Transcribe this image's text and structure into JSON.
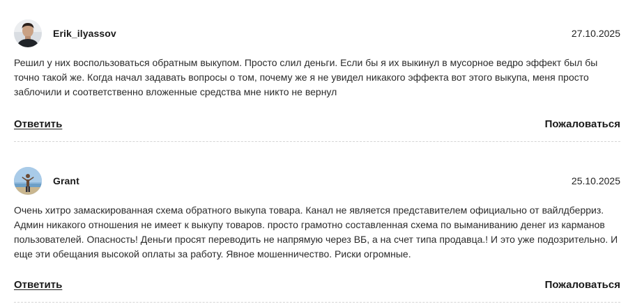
{
  "reviews": [
    {
      "author": "Erik_ilyassov",
      "date": "27.10.2025",
      "text": "Решил у них воспользоваться обратным выкупом. Просто слил деньги. Если бы я их выкинул в мусорное ведро эффект был бы точно такой же. Когда начал задавать вопросы о том, почему же я не увидел никакого эффекта вот этого выкупа, меня просто заблочили и соответственно вложенные средства мне никто не вернул",
      "reply_label": "Ответить",
      "complain_label": "Пожаловаться",
      "avatar_icon": "user-photo-avatar"
    },
    {
      "author": "Grant",
      "date": "25.10.2025",
      "text": "Очень хитро замаскированная схема обратного выкупа товара. Канал не является представителем официально от вайлдберриз. Админ никакого отношения не имеет к выкупу товаров. просто грамотно составленная схема по выманиванию денег из карманов пользователей. Опасность! Деньги просят переводить не напрямую через ВБ, а на счет типа продавца.! И это уже подозрительно. И еще эти обещания высокой оплаты за работу. Явное мошенничество. Риски огромные.",
      "reply_label": "Ответить",
      "complain_label": "Пожаловаться",
      "avatar_icon": "user-photo-avatar"
    }
  ],
  "colors": {
    "text": "#222222",
    "divider": "#d4d4d4",
    "background": "#ffffff"
  }
}
